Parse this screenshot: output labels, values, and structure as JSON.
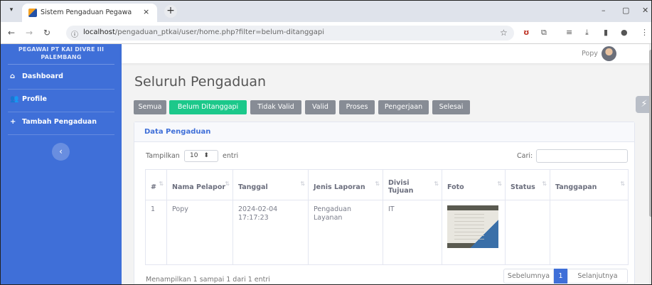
{
  "browser": {
    "tab_title": "Sistem Pengaduan Pegawai PT",
    "tab_close": "×",
    "new_tab": "+",
    "url_host": "localhost",
    "url_path": "/pengaduan_ptkai/user/home.php?filter=belum-ditanggapi",
    "window_controls": [
      "–",
      "▢",
      "✕"
    ]
  },
  "sidebar": {
    "brand_line1": "PEGAWAI PT KAI DIVRE III",
    "brand_line2": "PALEMBANG",
    "items": [
      {
        "label": "Dashboard",
        "icon": "home-icon"
      },
      {
        "label": "Profile",
        "icon": "users-icon"
      },
      {
        "label": "Tambah Pengaduan",
        "icon": "plus-icon"
      }
    ],
    "toggle": "‹"
  },
  "topbar": {
    "user_name": "Popy"
  },
  "main": {
    "title": "Seluruh Pengaduan",
    "filters": [
      "Semua",
      "Belum Ditanggapi",
      "Tidak Valid",
      "Valid",
      "Proses",
      "Pengerjaan",
      "Selesai"
    ],
    "active_filter": "Belum Ditanggapi",
    "active_color": "#1cc88a",
    "card_title": "Data Pengaduan",
    "length_label": "Tampilkan",
    "length_value": "10",
    "length_suffix": "entri",
    "search_label": "Cari:",
    "search_value": "",
    "columns": [
      "#",
      "Nama Pelapor",
      "Tanggal",
      "Jenis Laporan",
      "Divisi Tujuan",
      "Foto",
      "Status",
      "Tanggapan"
    ],
    "rows": [
      {
        "no": "1",
        "nama": "Popy",
        "tanggal": "2024-02-04 17:17:23",
        "jenis": "Pengaduan Layanan",
        "divisi": "IT",
        "foto": "photo",
        "status": "",
        "tanggapan": ""
      }
    ],
    "info": "Menampilkan 1 sampai 1 dari 1 entri",
    "pagination": {
      "prev": "Sebelumnya",
      "current": "1",
      "next": "Selanjutnya"
    }
  },
  "colors": {
    "sidebar": "#3f6fd8",
    "accent": "#3f6fd8",
    "filter_default": "#878c95"
  }
}
